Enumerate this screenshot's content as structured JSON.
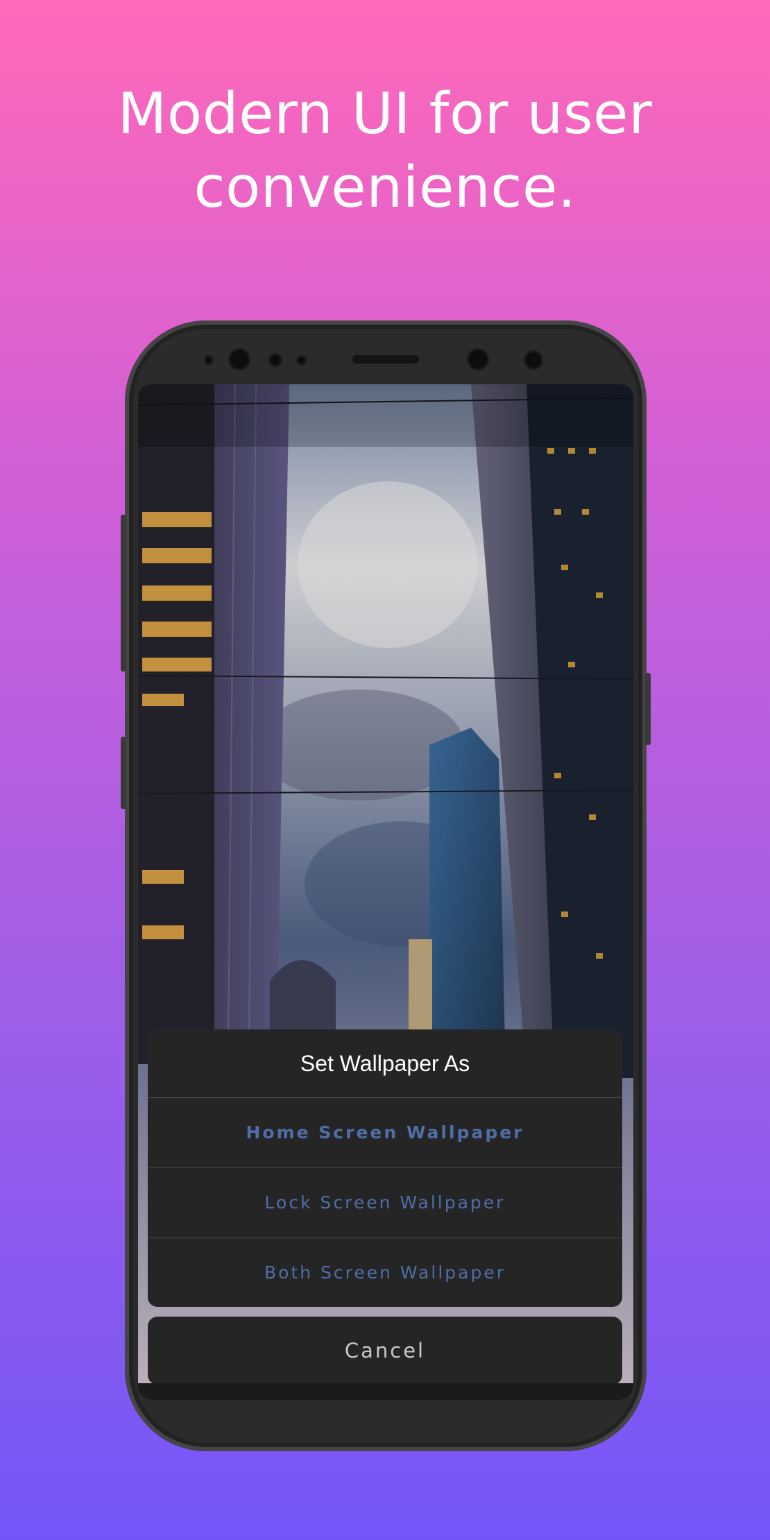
{
  "headline": {
    "line1": "Modern UI for user",
    "line2": "convenience."
  },
  "dialog": {
    "title": "Set Wallpaper As",
    "options": [
      {
        "label": "Home Screen Wallpaper"
      },
      {
        "label": "Lock Screen Wallpaper"
      },
      {
        "label": "Both Screen Wallpaper"
      }
    ],
    "cancel_label": "Cancel"
  },
  "colors": {
    "gradient_top": "#ff69b9",
    "gradient_bottom": "#7456f8",
    "dialog_bg": "#252525",
    "option_text": "#4f6ea8"
  }
}
